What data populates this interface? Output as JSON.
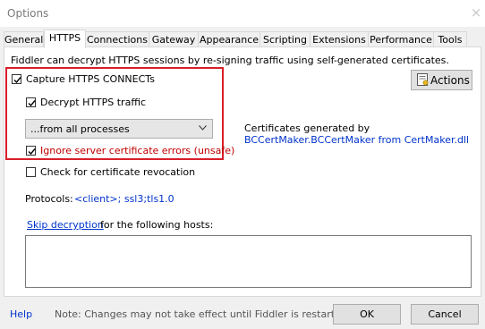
{
  "window": {
    "title": "Options",
    "close_glyph": "×"
  },
  "tabs": [
    {
      "label": "General"
    },
    {
      "label": "HTTPS"
    },
    {
      "label": "Connections"
    },
    {
      "label": "Gateway"
    },
    {
      "label": "Appearance"
    },
    {
      "label": "Scripting"
    },
    {
      "label": "Extensions"
    },
    {
      "label": "Performance"
    },
    {
      "label": "Tools"
    }
  ],
  "active_tab": "HTTPS",
  "https": {
    "intro": "Fiddler can decrypt HTTPS sessions by re-signing traffic using self-generated certificates.",
    "actions_label": "Actions",
    "capture_connects": {
      "label": "Capture HTTPS CONNECTs",
      "checked": true
    },
    "decrypt_traffic": {
      "label": "Decrypt HTTPS traffic",
      "checked": true
    },
    "process_filter": {
      "selected": "...from all processes"
    },
    "ignore_errors": {
      "label": "Ignore server certificate errors (unsafe)",
      "checked": true
    },
    "revocation": {
      "label": "Check for certificate revocation",
      "checked": false
    },
    "certs_generated_by": "Certificates generated by",
    "cert_maker_link": "BCCertMaker.BCCertMaker from CertMaker.dll",
    "protocols_label": "Protocols:",
    "protocols_value": "<client>; ssl3;tls1.0",
    "skip_decryption_link": "Skip decryption",
    "skip_decryption_suffix": "for the following hosts:",
    "hosts_value": ""
  },
  "footer": {
    "help": "Help",
    "note": "Note: Changes may not take effect until Fiddler is restarted.",
    "ok": "OK",
    "cancel": "Cancel"
  },
  "colors": {
    "highlight": "#d91e2a",
    "link": "#0033cc",
    "warning_text": "#c00000"
  }
}
